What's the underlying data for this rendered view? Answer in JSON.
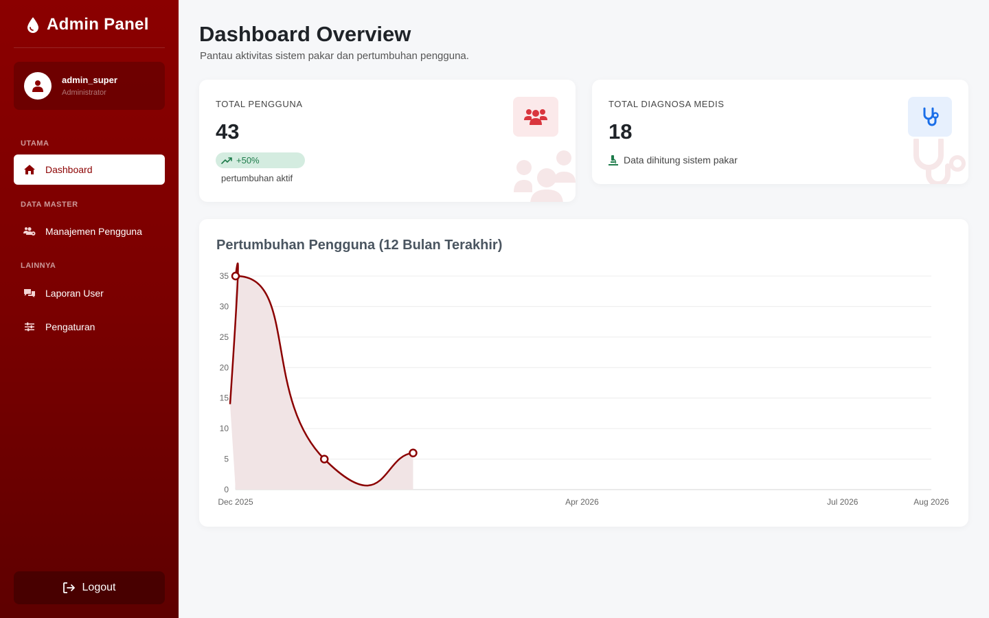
{
  "sidebar": {
    "brand": "Admin Panel",
    "user": {
      "name": "admin_super",
      "role": "Administrator"
    },
    "sections": {
      "utama": "UTAMA",
      "data_master": "DATA MASTER",
      "lainnya": "LAINNYA"
    },
    "items": {
      "dashboard": "Dashboard",
      "users": "Manajemen Pengguna",
      "reports": "Laporan User",
      "settings": "Pengaturan"
    },
    "logout": "Logout",
    "accent_color": "#8b0000"
  },
  "main": {
    "title": "Dashboard Overview",
    "subtitle": "Pantau aktivitas sistem pakar dan pertumbuhan pengguna.",
    "stats": {
      "users": {
        "label": "TOTAL PENGGUNA",
        "value": "43",
        "growth": "+50%",
        "growth_note": "pertumbuhan aktif",
        "icon": "users-icon"
      },
      "diagnoses": {
        "label": "TOTAL DIAGNOSA MEDIS",
        "value": "18",
        "note": "Data dihitung sistem pakar",
        "icon": "stethoscope-icon"
      }
    },
    "chart_title": "Pertumbuhan Pengguna (12 Bulan Terakhir)"
  },
  "chart_data": {
    "type": "area",
    "title": "Pertumbuhan Pengguna (12 Bulan Terakhir)",
    "x_tick_labels": [
      "Dec 2025",
      "Apr 2026",
      "Jul 2026",
      "Aug 2026"
    ],
    "points": [
      {
        "x": "2025-12",
        "y": 35
      },
      {
        "x": "2026-01",
        "y": 5
      },
      {
        "x": "2026-02",
        "y": 6
      }
    ],
    "ylim": [
      0,
      35
    ],
    "yticks": [
      0,
      5,
      10,
      15,
      20,
      25,
      30,
      35
    ],
    "grid": true,
    "line_color": "#8b0000",
    "fill_color": "#f1e4e5"
  }
}
